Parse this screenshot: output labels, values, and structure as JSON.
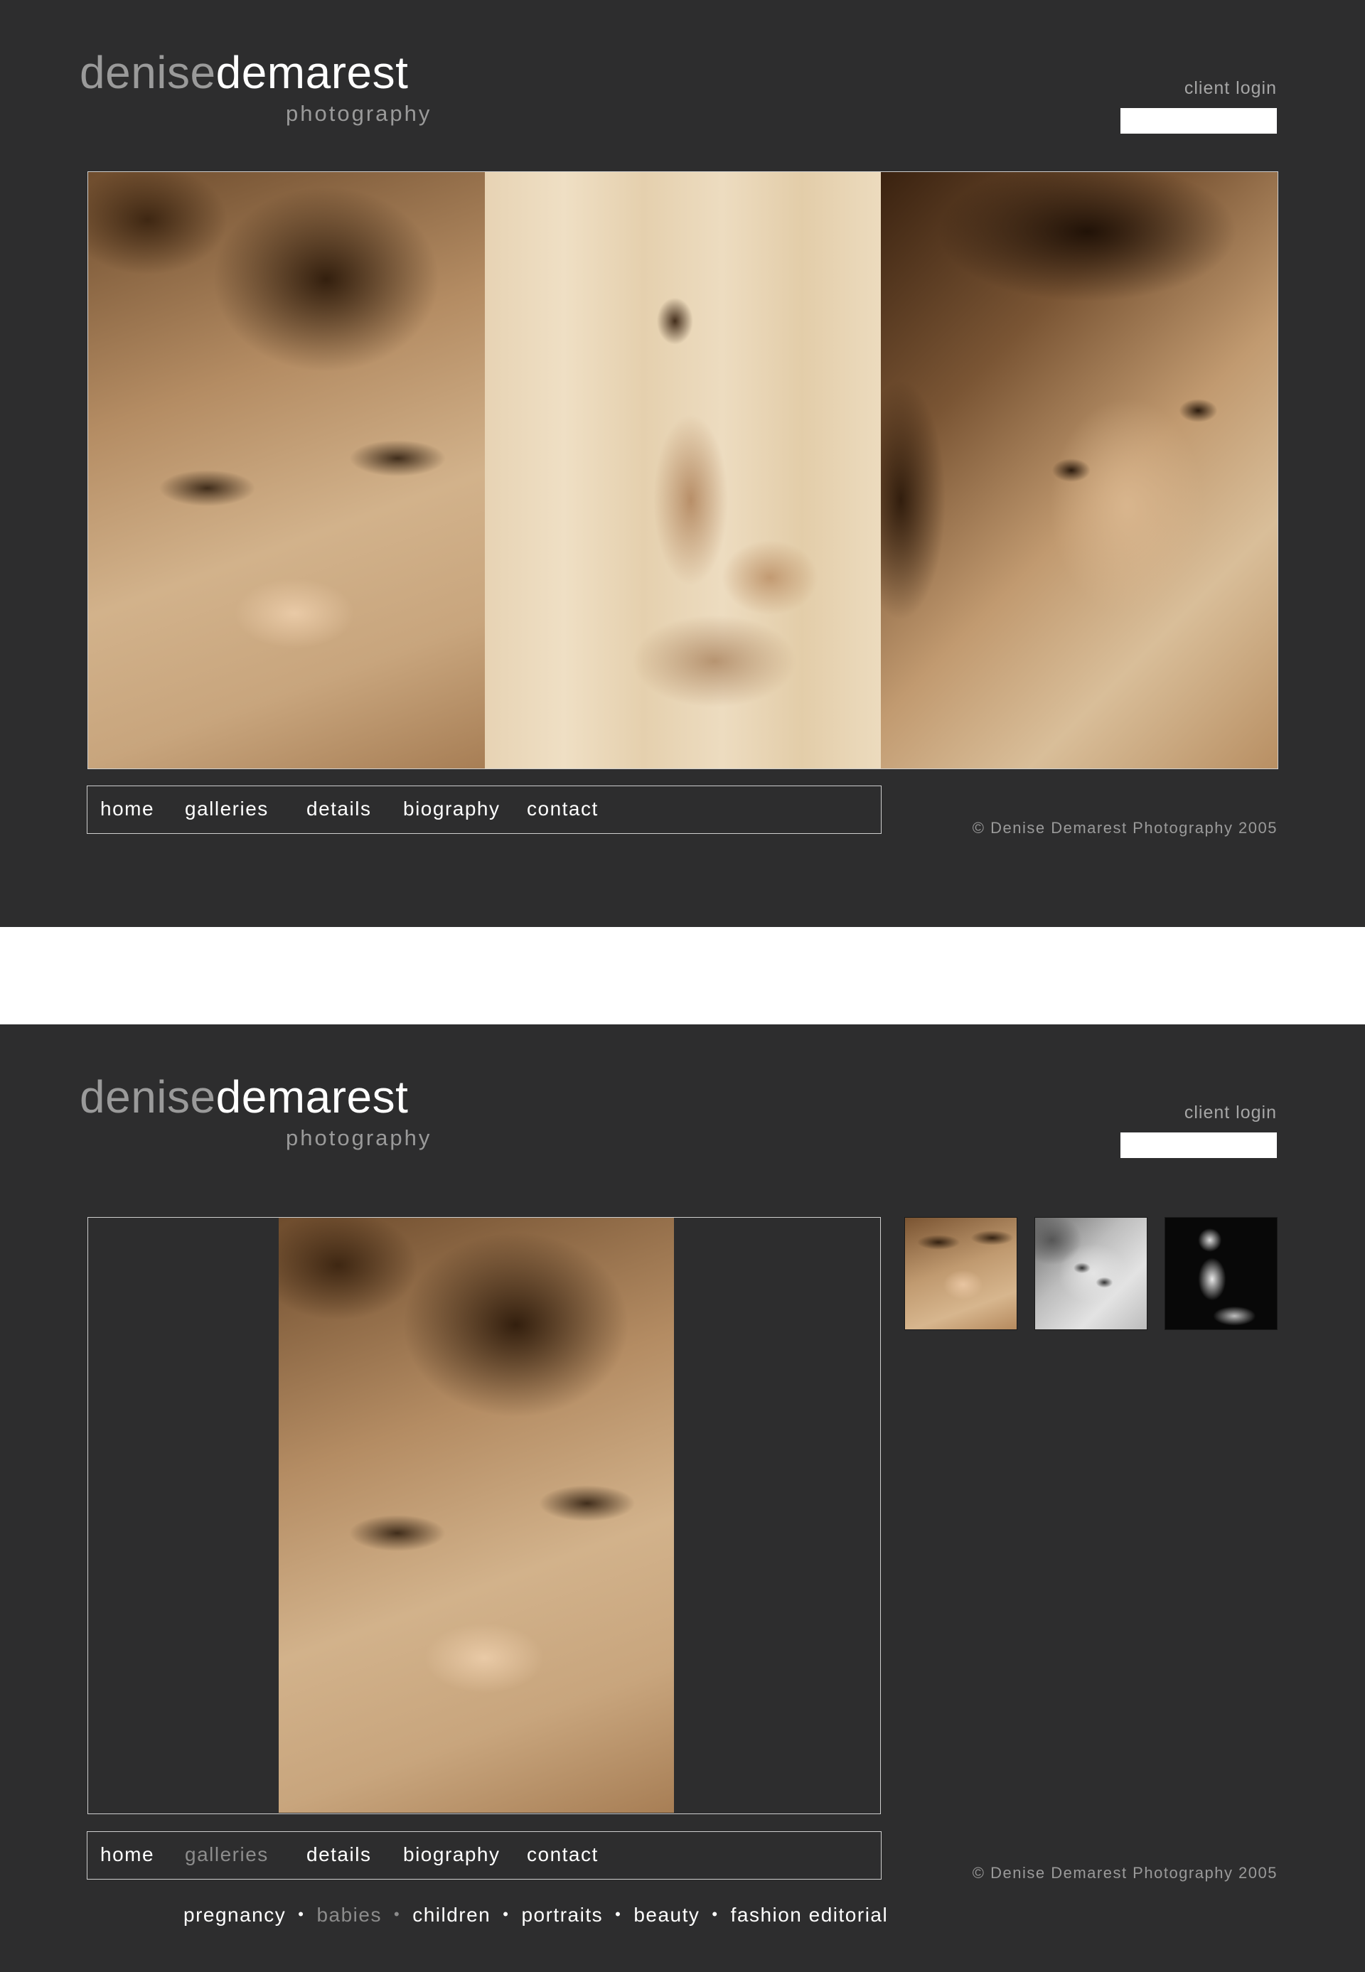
{
  "brand": {
    "name_light": "denise",
    "name_bold": "demarest",
    "subtitle": "photography"
  },
  "login": {
    "label": "client login",
    "value": ""
  },
  "nav": {
    "home": "home",
    "galleries": "galleries",
    "details": "details",
    "biography": "biography",
    "contact": "contact"
  },
  "footer": {
    "copyright": "© Denise Demarest Photography 2005"
  },
  "gallery": {
    "active_nav": "galleries",
    "categories": [
      "pregnancy",
      "babies",
      "children",
      "portraits",
      "beauty",
      "fashion editorial"
    ],
    "active_category": "babies",
    "separator": "•"
  },
  "colors": {
    "background": "#2d2d2e",
    "text": "#ffffff",
    "muted": "#9a9a9a",
    "accent_sepia": "#b48c63"
  }
}
